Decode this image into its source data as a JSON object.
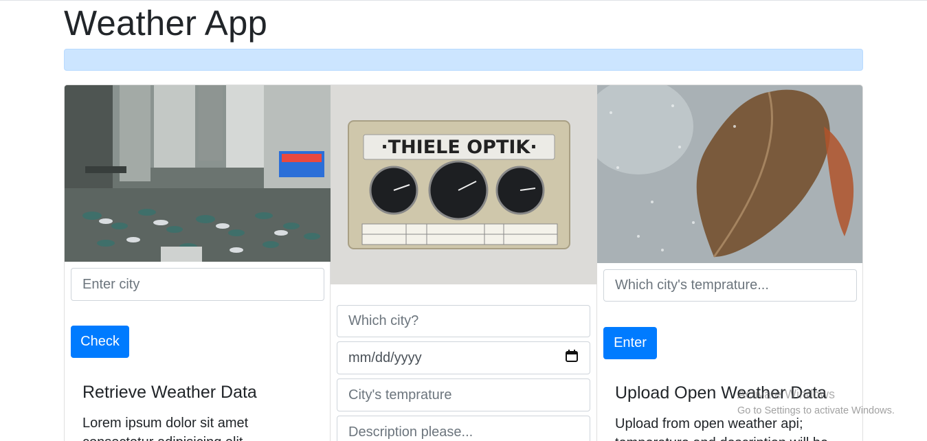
{
  "header": {
    "title": "Weather App"
  },
  "cards": [
    {
      "input_placeholder": "Enter city",
      "button_label": "Check",
      "title": "Retrieve Weather Data",
      "text_line1": "Lorem ipsum dolor sit amet",
      "text_line2": "consectetur adipisicing elit"
    },
    {
      "sign_text": "·THIELE  OPTIK·",
      "city_placeholder": "Which city?",
      "date_placeholder": "mm/dd/yyyy",
      "temp_placeholder": "City's temprature",
      "desc_placeholder": "Description please..."
    },
    {
      "input_placeholder": "Which city's temprature...",
      "button_label": "Enter",
      "title": "Upload Open Weather Data",
      "text_line1": "Upload from open weather api;",
      "text_line2": "temperature and description will be"
    }
  ],
  "watermark": {
    "line1": "Activate Windows",
    "line2": "Go to Settings to activate Windows."
  },
  "colors": {
    "primary": "#007bff",
    "alert_bg": "#cce5ff"
  }
}
